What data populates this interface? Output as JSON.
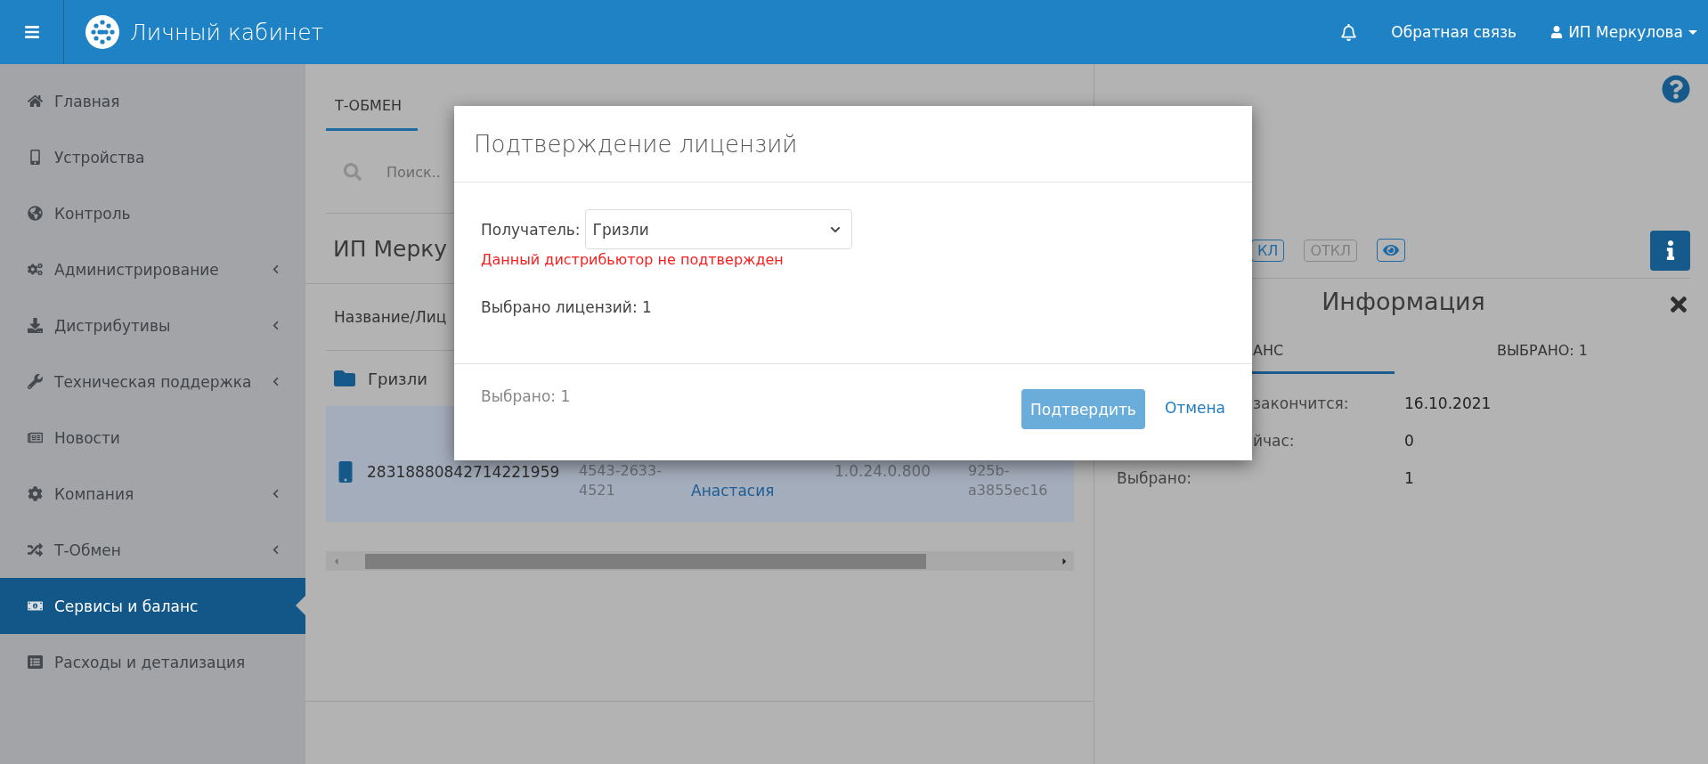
{
  "header": {
    "title": "Личный кабинет",
    "feedback": "Обратная связь",
    "user": "ИП Меркулова"
  },
  "sidebar": {
    "items": [
      {
        "label": "Главная",
        "expandable": false,
        "selected": false
      },
      {
        "label": "Устройства",
        "expandable": false,
        "selected": false
      },
      {
        "label": "Контроль",
        "expandable": false,
        "selected": false
      },
      {
        "label": "Администрирование",
        "expandable": true,
        "selected": false
      },
      {
        "label": "Дистрибутивы",
        "expandable": true,
        "selected": false
      },
      {
        "label": "Техническая поддержка",
        "expandable": true,
        "selected": false
      },
      {
        "label": "Новости",
        "expandable": false,
        "selected": false
      },
      {
        "label": "Компания",
        "expandable": true,
        "selected": false
      },
      {
        "label": "Т-Обмен",
        "expandable": true,
        "selected": false
      },
      {
        "label": "Сервисы и баланс",
        "expandable": false,
        "selected": true
      },
      {
        "label": "Расходы и детализация",
        "expandable": false,
        "selected": false
      }
    ]
  },
  "main": {
    "tabs": [
      {
        "label": "Т-ОБМЕН",
        "selected": true
      }
    ],
    "search": {
      "placeholder": "Поиск.."
    },
    "title": "ИП Мерку",
    "column_1": "Название/Лиц",
    "folder": "Гризли",
    "rows": [
      {
        "selected": true,
        "cells": [
          "28318880842714221959",
          "4543-2633-4521",
          "Анастасия",
          "1.0.24.0.800",
          "925b-a3855ec16"
        ]
      }
    ]
  },
  "info_panel": {
    "buttons": [
      {
        "label": "КЛ",
        "active": true
      },
      {
        "label": "ОТКЛ",
        "active": false
      }
    ],
    "title": "Информация",
    "tabs": [
      {
        "label": "АНС",
        "selected": true
      },
      {
        "label": "ВЫБРАНО: 1",
        "selected": false
      }
    ],
    "rows": [
      {
        "label": "закончится:",
        "value": "16.10.2021",
        "cut": true
      },
      {
        "label": "йчас:",
        "value": "0",
        "cut": true
      },
      {
        "label": "Выбрано:",
        "value": "1",
        "cut": false
      }
    ]
  },
  "dialog": {
    "title": "Подтверждение лицензий",
    "recipient_label": "Получатель:",
    "recipient_value": "Гризли",
    "error": "Данный дистрибьютор не подтвержден",
    "selected_licenses": "Выбрано лицензий: 1",
    "footer_note": "Выбрано: 1",
    "confirm": {
      "label": "Подтвердить",
      "disabled": true
    },
    "cancel": "Отмена"
  }
}
